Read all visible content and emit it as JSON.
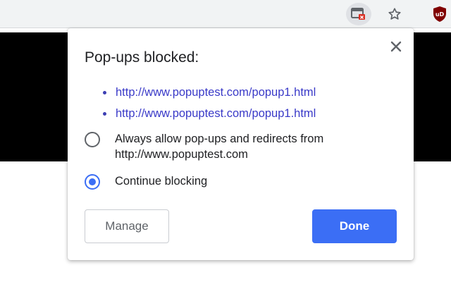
{
  "toolbar": {
    "icons": [
      "popup-blocked-icon",
      "star-icon",
      "ublock-origin-icon"
    ],
    "ublock_badge": "uD"
  },
  "bubble": {
    "title": "Pop-ups blocked:",
    "links": [
      "http://www.popuptest.com/popup1.html",
      "http://www.popuptest.com/popup1.html"
    ],
    "options": [
      {
        "label_line1": "Always allow pop-ups and redirects from",
        "label_line2": "http://www.popuptest.com",
        "checked": false
      },
      {
        "label_line1": "Continue blocking",
        "label_line2": "",
        "checked": true
      }
    ],
    "manage_label": "Manage",
    "done_label": "Done",
    "accent_color": "#3b6ef5"
  }
}
